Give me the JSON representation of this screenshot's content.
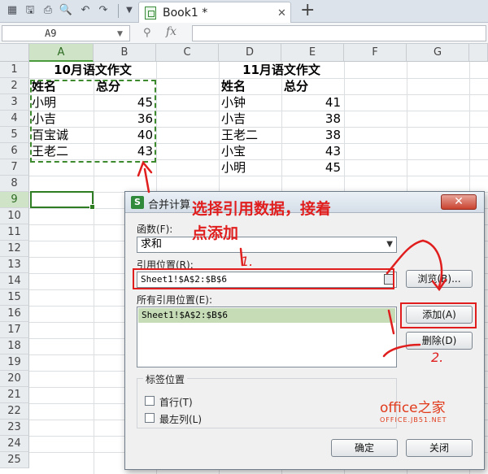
{
  "tab": {
    "title": "Book1 *",
    "close": "✕",
    "new": "+"
  },
  "formula_bar": {
    "cell_ref": "A9",
    "fx": "fx"
  },
  "columns": [
    "A",
    "B",
    "C",
    "D",
    "E",
    "F",
    "G"
  ],
  "rows": [
    "1",
    "2",
    "3",
    "4",
    "5",
    "6",
    "7",
    "8",
    "9",
    "10",
    "11",
    "12",
    "13",
    "14",
    "15",
    "16",
    "17",
    "18",
    "19",
    "20",
    "21",
    "22",
    "23",
    "24",
    "25"
  ],
  "sheet": {
    "oct_title": "10月语文作文",
    "nov_title": "11月语文作文",
    "header_name": "姓名",
    "header_score": "总分",
    "oct_rows": [
      {
        "name": "小明",
        "score": "45"
      },
      {
        "name": "小吉",
        "score": "36"
      },
      {
        "name": "百宝诚",
        "score": "40"
      },
      {
        "name": "王老二",
        "score": "43"
      }
    ],
    "nov_rows": [
      {
        "name": "小钟",
        "score": "41"
      },
      {
        "name": "小吉",
        "score": "38"
      },
      {
        "name": "王老二",
        "score": "38"
      },
      {
        "name": "小宝",
        "score": "43"
      },
      {
        "name": "小明",
        "score": "45"
      }
    ]
  },
  "dialog": {
    "title": "合并计算",
    "close": "✕",
    "function_label": "函数(F):",
    "function_value": "求和",
    "reference_label": "引用位置(R):",
    "reference_value": "Sheet1!$A$2:$B$6",
    "browse_button": "浏览(B)...",
    "all_refs_label": "所有引用位置(E):",
    "all_refs": [
      "Sheet1!$A$2:$B$6"
    ],
    "add_button": "添加(A)",
    "delete_button": "删除(D)",
    "label_group": "标签位置",
    "first_row": "首行(T)",
    "left_column": "最左列(L)",
    "ok_button": "确定",
    "close_button": "关闭"
  },
  "annotation": {
    "line1": "选择引用数据，接着",
    "line2": "点添加",
    "mark1": "1.",
    "mark2": "2."
  },
  "watermark": {
    "main": "office之家",
    "sub": "OFFICE.JB51.NET"
  },
  "colors": {
    "accent_green": "#3d8a2e",
    "annotation_red": "#e01e1e"
  }
}
